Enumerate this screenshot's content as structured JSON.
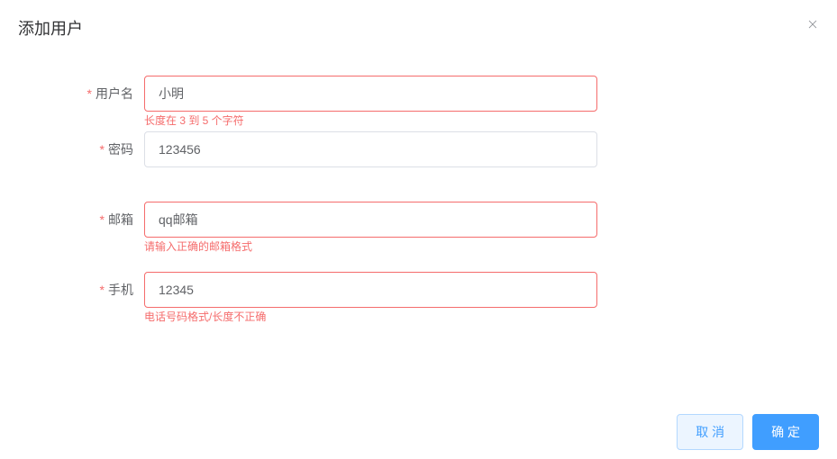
{
  "dialog": {
    "title": "添加用户"
  },
  "form": {
    "username": {
      "label": "用户名",
      "value": "小明",
      "error": "长度在 3 到 5 个字符"
    },
    "password": {
      "label": "密码",
      "value": "123456",
      "error": ""
    },
    "email": {
      "label": "邮箱",
      "value": "qq邮箱",
      "error": "请输入正确的邮箱格式"
    },
    "mobile": {
      "label": "手机",
      "value": "12345",
      "error": "电话号码格式/长度不正确"
    }
  },
  "footer": {
    "cancel": "取 消",
    "confirm": "确 定"
  }
}
